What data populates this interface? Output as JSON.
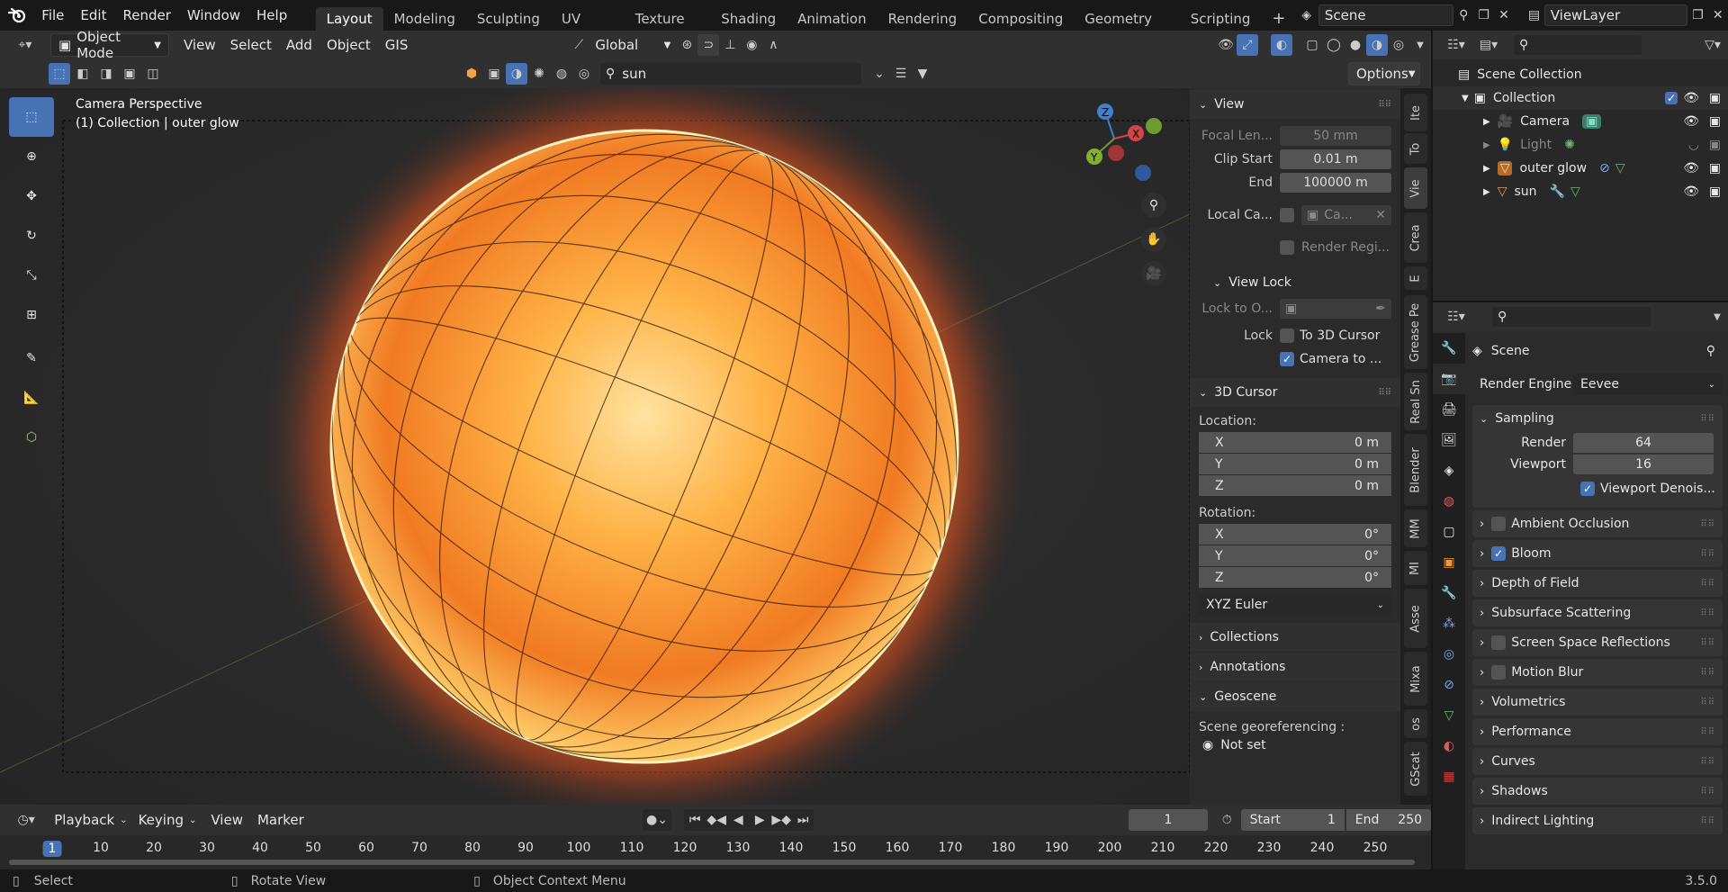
{
  "menu": {
    "file": "File",
    "edit": "Edit",
    "render": "Render",
    "window": "Window",
    "help": "Help"
  },
  "workspaces": [
    "Layout",
    "Modeling",
    "Sculpting",
    "UV Editing",
    "Texture Paint",
    "Shading",
    "Animation",
    "Rendering",
    "Compositing",
    "Geometry Nodes",
    "Scripting"
  ],
  "active_workspace": "Layout",
  "scene_name": "Scene",
  "view_layer": "ViewLayer",
  "viewport_header": {
    "mode": "Object Mode",
    "view": "View",
    "select": "Select",
    "add": "Add",
    "object": "Object",
    "gis": "GIS",
    "orientation": "Global",
    "search_value": "sun",
    "options": "Options"
  },
  "viewport": {
    "perspective": "Camera Perspective",
    "collection_info": "(1) Collection | outer glow"
  },
  "npanel": {
    "view_title": "View",
    "focal_label": "Focal Len...",
    "focal_value": "50 mm",
    "clip_start_label": "Clip Start",
    "clip_start_value": "0.01 m",
    "clip_end_label": "End",
    "clip_end_value": "100000 m",
    "local_camera_label": "Local Ca...",
    "local_camera_value": "Ca...",
    "render_region_label": "Render Regi...",
    "view_lock_title": "View Lock",
    "lock_to_label": "Lock to O...",
    "lock_label": "Lock",
    "lock_cursor": "To 3D Cursor",
    "lock_camera": "Camera to ...",
    "cursor_title": "3D Cursor",
    "location_label": "Location:",
    "loc": [
      {
        "axis": "X",
        "value": "0 m"
      },
      {
        "axis": "Y",
        "value": "0 m"
      },
      {
        "axis": "Z",
        "value": "0 m"
      }
    ],
    "rotation_label": "Rotation:",
    "rot": [
      {
        "axis": "X",
        "value": "0°"
      },
      {
        "axis": "Y",
        "value": "0°"
      },
      {
        "axis": "Z",
        "value": "0°"
      }
    ],
    "rotation_mode": "XYZ Euler",
    "collections": "Collections",
    "annotations": "Annotations",
    "geoscene": "Geoscene",
    "georef_label": "Scene georeferencing :",
    "not_set": "Not set"
  },
  "sidetabs": [
    "Ite",
    "To",
    "Vie",
    "Crea",
    "E",
    "Grease Pe",
    "Real Sn",
    "Blender",
    "MM",
    "MI",
    "Asse",
    "Mixa",
    "os",
    "GScat"
  ],
  "outliner": {
    "search_placeholder": "",
    "scene_collection": "Scene Collection",
    "collection": "Collection",
    "items": [
      "Camera",
      "Light",
      "outer glow",
      "sun"
    ]
  },
  "properties": {
    "scene_label": "Scene",
    "render_engine_label": "Render Engine",
    "render_engine_value": "Eevee",
    "sampling": "Sampling",
    "render_label": "Render",
    "render_value": "64",
    "viewport_label": "Viewport",
    "viewport_value": "16",
    "viewport_denoise": "Viewport Denois...",
    "panels": [
      "Ambient Occlusion",
      "Bloom",
      "Depth of Field",
      "Subsurface Scattering",
      "Screen Space Reflections",
      "Motion Blur",
      "Volumetrics",
      "Performance",
      "Curves",
      "Shadows",
      "Indirect Lighting"
    ]
  },
  "timeline": {
    "playback": "Playback",
    "keying": "Keying",
    "view": "View",
    "marker": "Marker",
    "current_frame": "1",
    "start_label": "Start",
    "start_value": "1",
    "end_label": "End",
    "end_value": "250",
    "ticks": [
      "1",
      "10",
      "20",
      "30",
      "40",
      "50",
      "60",
      "70",
      "80",
      "90",
      "100",
      "110",
      "120",
      "130",
      "140",
      "150",
      "160",
      "170",
      "180",
      "190",
      "200",
      "210",
      "220",
      "230",
      "240",
      "250"
    ]
  },
  "status": {
    "select": "Select",
    "rotate": "Rotate View",
    "context": "Object Context Menu",
    "version": "3.5.0"
  },
  "colors": {
    "accent": "#4772b3",
    "sun_core": "#ffb347",
    "sun_edge": "#e8641a"
  }
}
